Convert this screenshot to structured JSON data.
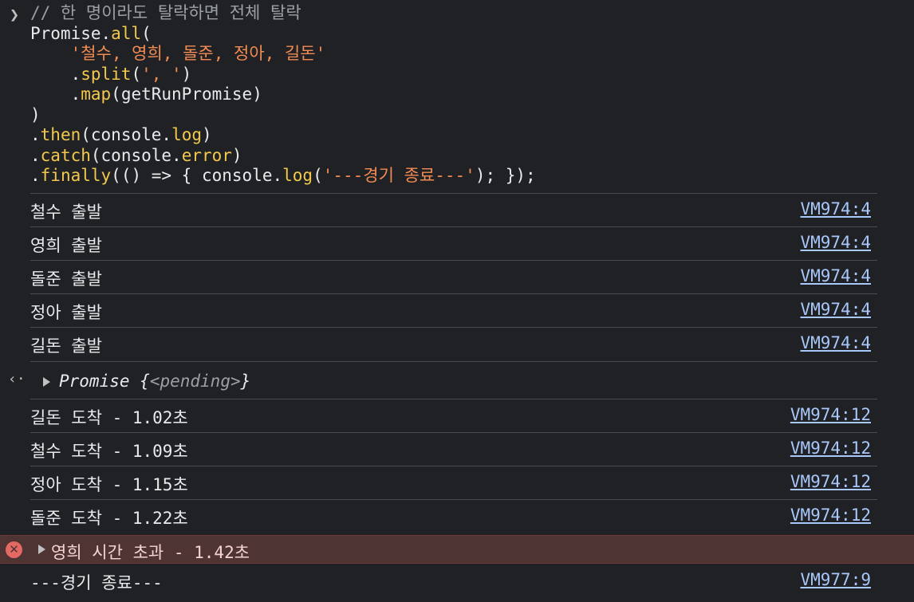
{
  "input": {
    "comment": "// 한 명이라도 탈락하면 전체 탈락",
    "promise_obj": "Promise",
    "all_fn": "all",
    "names_str": "'철수, 영희, 돌준, 정아, 길돈'",
    "split_fn": "split",
    "split_arg": "', '",
    "map_fn": "map",
    "map_arg": "getRunPromise",
    "then_fn": "then",
    "catch_fn": "catch",
    "finally_fn": "finally",
    "console_obj": "console",
    "log_fn": "log",
    "error_fn": "error",
    "finally_msg": "'---경기 종료---'"
  },
  "logs": [
    {
      "message": "철수 출발",
      "source": "VM974:4"
    },
    {
      "message": "영희 출발",
      "source": "VM974:4"
    },
    {
      "message": "돌준 출발",
      "source": "VM974:4"
    },
    {
      "message": "정아 출발",
      "source": "VM974:4"
    },
    {
      "message": "길돈 출발",
      "source": "VM974:4"
    }
  ],
  "result": {
    "label": "Promise",
    "state": "<pending>"
  },
  "arrivals": [
    {
      "message": "길돈 도착 - 1.02초",
      "source": "VM974:12"
    },
    {
      "message": "철수 도착 - 1.09초",
      "source": "VM974:12"
    },
    {
      "message": "정아 도착 - 1.15초",
      "source": "VM974:12"
    },
    {
      "message": "돌준 도착 - 1.22초",
      "source": "VM974:12"
    }
  ],
  "error": {
    "message": "영희 시간 초과 - 1.42초"
  },
  "final_log": {
    "message": "---경기 종료---",
    "source": "VM977:9"
  },
  "colors": {
    "background": "#202124",
    "string": "#f28b54",
    "function": "#f2c94c",
    "link": "#a8c7fa",
    "error_bg": "#4e3534",
    "error_icon": "#e46962"
  }
}
